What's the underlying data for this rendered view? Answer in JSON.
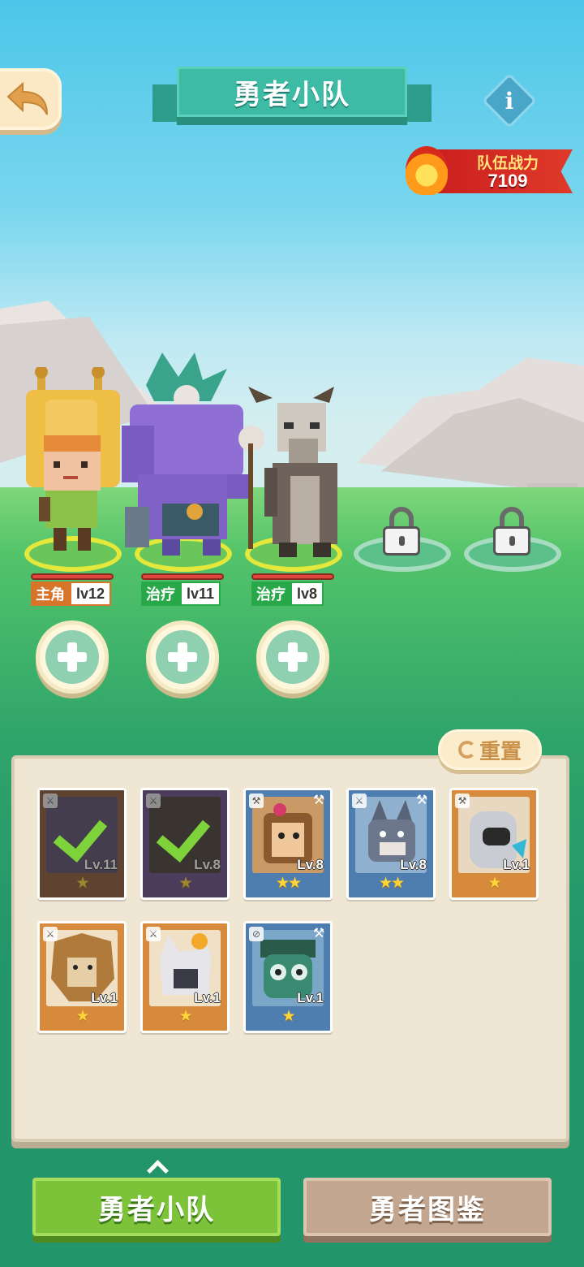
{
  "header": {
    "title": "勇者小队",
    "info_label": "i"
  },
  "power": {
    "label": "队伍战力",
    "value": "7109"
  },
  "heroes": [
    {
      "role": "主角",
      "level": "lv12"
    },
    {
      "role": "治疗",
      "level": "lv11"
    },
    {
      "role": "治疗",
      "level": "lv8"
    }
  ],
  "reset": {
    "label": "重置"
  },
  "cards": [
    {
      "level": "Lv.11",
      "stars": "★",
      "selected": true
    },
    {
      "level": "Lv.8",
      "stars": "★",
      "selected": true
    },
    {
      "level": "Lv.8",
      "stars": "★★",
      "selected": false
    },
    {
      "level": "Lv.8",
      "stars": "★★",
      "selected": false
    },
    {
      "level": "Lv.1",
      "stars": "★",
      "selected": false
    },
    {
      "level": "Lv.1",
      "stars": "★",
      "selected": false
    },
    {
      "level": "Lv.1",
      "stars": "★",
      "selected": false
    },
    {
      "level": "Lv.1",
      "stars": "★",
      "selected": false
    }
  ],
  "tabs": {
    "team": "勇者小队",
    "codex": "勇者图鉴"
  },
  "colors": {
    "sky": "#4cc6e9",
    "grass": "#3fb36a",
    "panel": "#efe6d4",
    "accent_green": "#7cc33a",
    "banner_teal": "#3dbba5",
    "power_red": "#c81e1e"
  }
}
